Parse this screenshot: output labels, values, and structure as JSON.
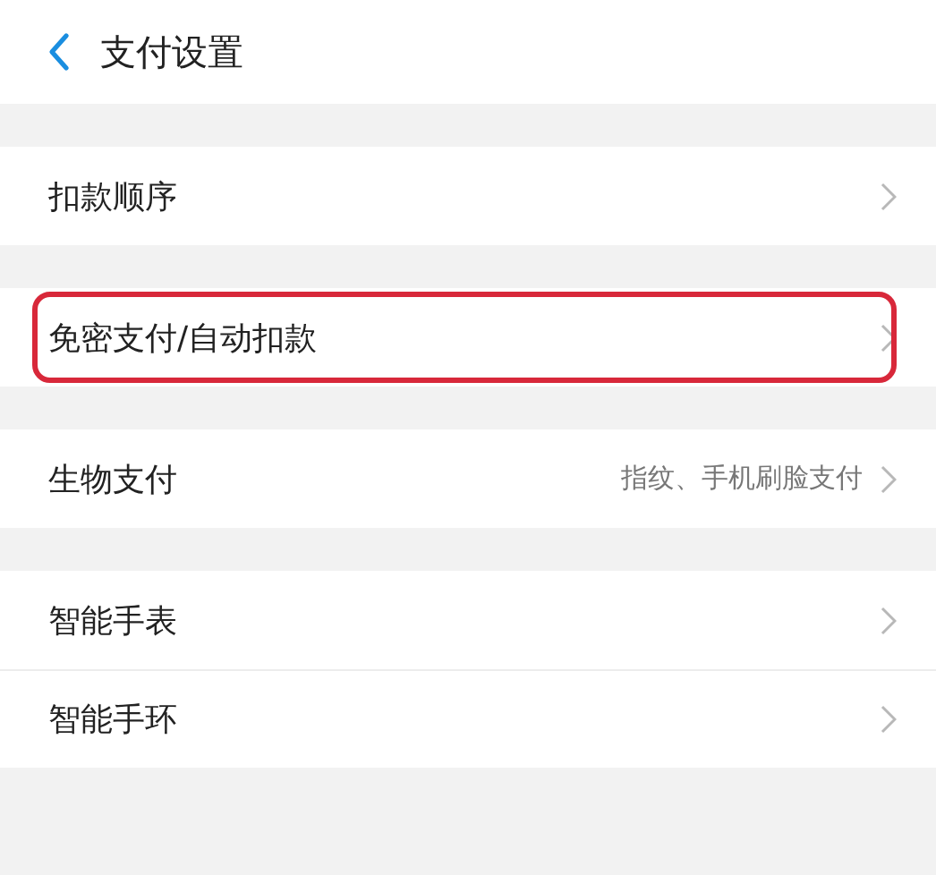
{
  "header": {
    "title": "支付设置"
  },
  "groups": [
    {
      "items": [
        {
          "label": "扣款顺序",
          "highlighted": false
        }
      ]
    },
    {
      "items": [
        {
          "label": "免密支付/自动扣款",
          "highlighted": true
        }
      ]
    },
    {
      "items": [
        {
          "label": "生物支付",
          "value": "指纹、手机刷脸支付",
          "highlighted": false
        }
      ]
    },
    {
      "items": [
        {
          "label": "智能手表",
          "highlighted": false
        },
        {
          "label": "智能手环",
          "highlighted": false
        }
      ]
    }
  ]
}
